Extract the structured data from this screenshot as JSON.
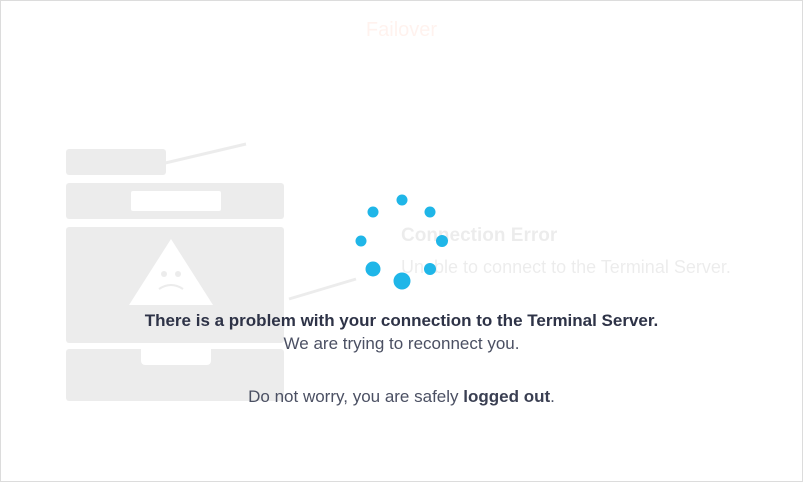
{
  "background": {
    "title": "Failover",
    "error_title": "Connection Error",
    "error_text": "Unable to connect to the Terminal Server."
  },
  "message": {
    "main": "There is a problem with your connection to the Terminal Server.",
    "sub": "We are trying to reconnect you.",
    "safe_prefix": "Do not worry, you are safely ",
    "safe_bold": "logged out",
    "safe_suffix": "."
  },
  "colors": {
    "spinner": "#1fb6e8",
    "brand": "#ff5a1f"
  },
  "icons": {
    "spinner": "loading-spinner-icon",
    "warning": "warning-triangle-icon"
  }
}
